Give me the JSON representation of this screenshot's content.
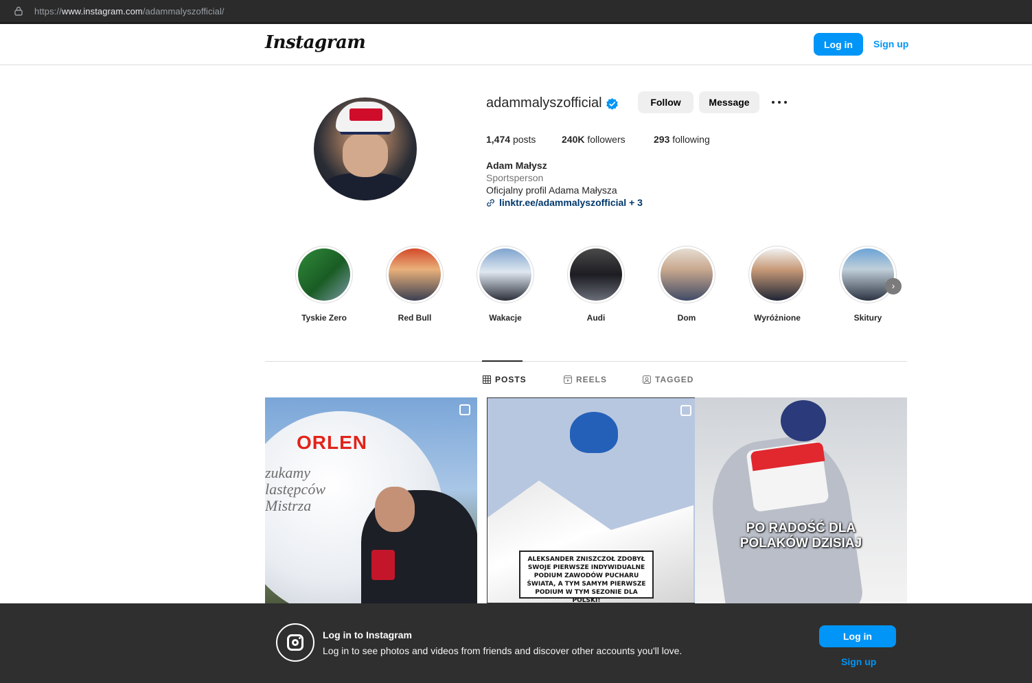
{
  "browser": {
    "url_scheme": "https://",
    "url_host": "www.instagram.com",
    "url_path": "/adammalyszofficial/"
  },
  "nav": {
    "logo": "Instagram",
    "login_label": "Log in",
    "signup_label": "Sign up"
  },
  "profile": {
    "username": "adammalyszofficial",
    "verified": true,
    "follow_label": "Follow",
    "message_label": "Message",
    "posts_count": "1,474",
    "posts_label": "posts",
    "followers_count": "240K",
    "followers_label": "followers",
    "following_count": "293",
    "following_label": "following",
    "full_name": "Adam Małysz",
    "category": "Sportsperson",
    "bio": "Oficjalny profil Adama Małysza",
    "link_text": "linktr.ee/adammalyszofficial + 3"
  },
  "highlights": [
    {
      "label": "Tyskie Zero"
    },
    {
      "label": "Red Bull"
    },
    {
      "label": "Wakacje"
    },
    {
      "label": "Audi"
    },
    {
      "label": "Dom"
    },
    {
      "label": "Wyróżnione"
    },
    {
      "label": "Skitury"
    }
  ],
  "tabs": {
    "posts": "POSTS",
    "reels": "REELS",
    "tagged": "TAGGED"
  },
  "posts": {
    "p1_brand": "ORLEN",
    "p1_slogan_1": "zukamy",
    "p1_slogan_2": "lastępców",
    "p1_slogan_3": "Mistrza",
    "p2_caption": "ALEKSANDER ZNISZCZOŁ ZDOBYŁ SWOJE PIERWSZE INDYWIDUALNE PODIUM ZAWODÓW PUCHARU ŚWIATA, A TYM SAMYM PIERWSZE PODIUM W TYM SEZONIE DLA POLSKI!",
    "p3_line1": "PO RADOŚĆ DLA",
    "p3_line2": "POLAKÓW DZISIAJ"
  },
  "banner": {
    "title": "Log in to Instagram",
    "subtitle": "Log in to see photos and videos from friends and discover other accounts you'll love.",
    "login_label": "Log in",
    "signup_label": "Sign up"
  },
  "colors": {
    "accent": "#0095f6",
    "link": "#00376b",
    "verified": "#0095f6"
  }
}
